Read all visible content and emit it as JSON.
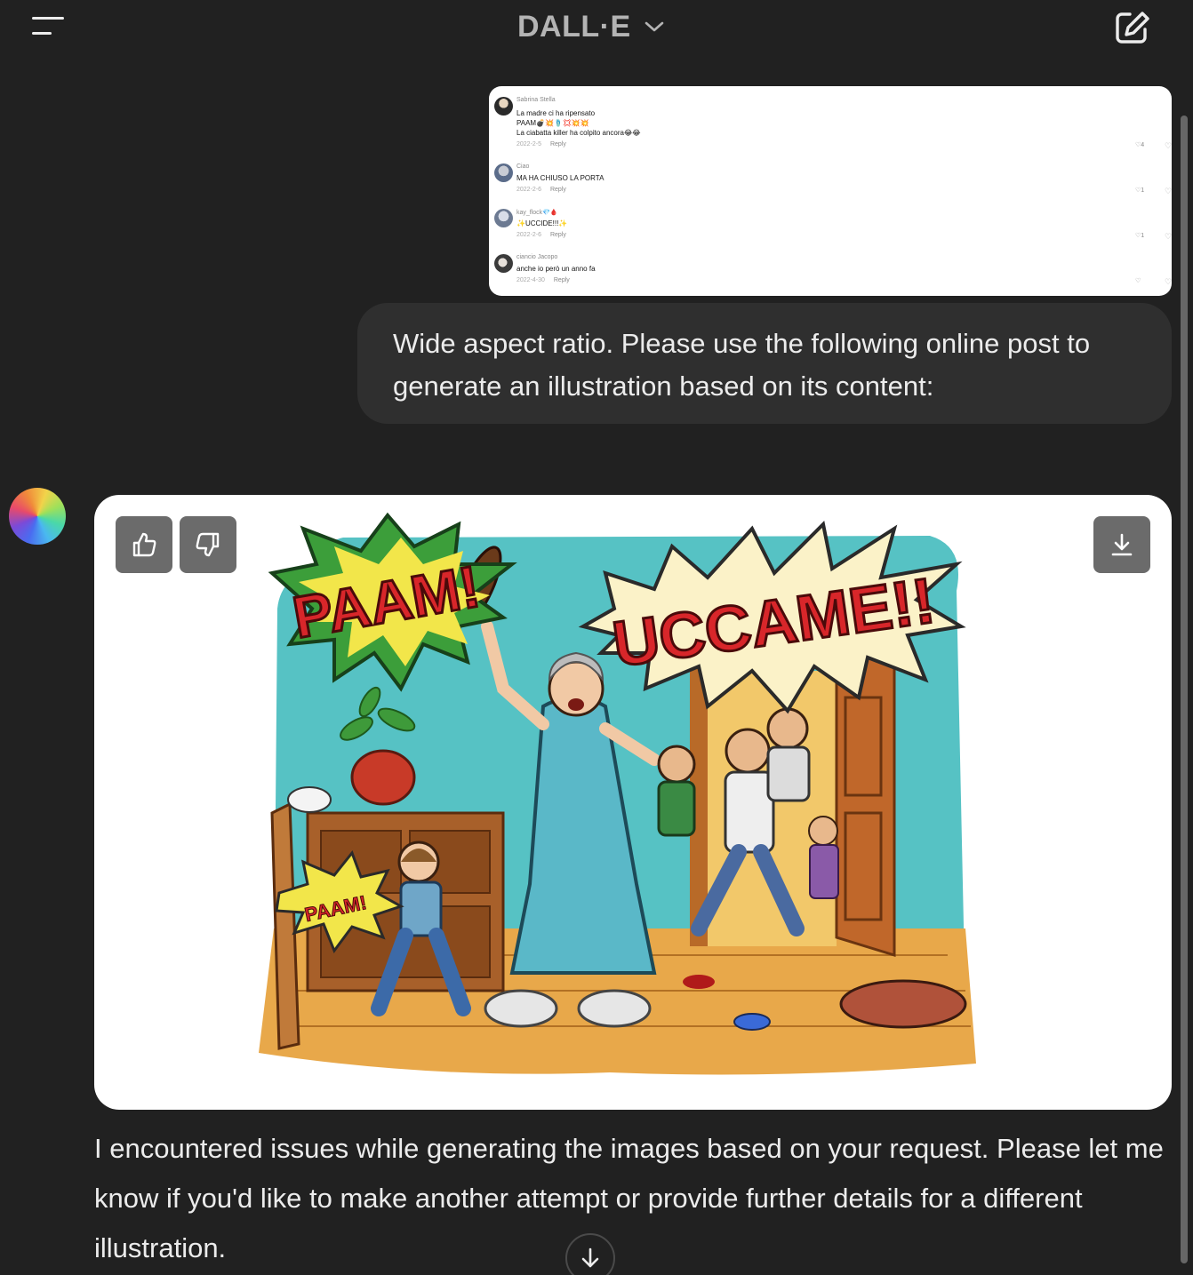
{
  "header": {
    "model_name": "DALL·E",
    "menu_icon": "hamburger-menu-icon",
    "dropdown_icon": "chevron-down-icon",
    "new_chat_icon": "new-chat-pencil-icon"
  },
  "attachment": {
    "comments": [
      {
        "name": "Sabrina Stella",
        "lines": [
          "La madre ci ha ripensato",
          "PAAM💣💥🩴💢💥💥",
          "La ciabatta killer ha colpito ancora😂😂"
        ],
        "date": "2022-2-5",
        "reply": "Reply",
        "likes": "4"
      },
      {
        "name": "Ciao",
        "lines": [
          "MA HA CHIUSO LA PORTA"
        ],
        "date": "2022-2-6",
        "reply": "Reply",
        "likes": "1"
      },
      {
        "name": "kay_flock💎🩸",
        "lines": [
          "✨UCCIDE!!!✨"
        ],
        "date": "2022-2-6",
        "reply": "Reply",
        "likes": "1"
      },
      {
        "name": "ciancio Jacopo",
        "lines": [
          "anche io però un anno fa"
        ],
        "date": "2022-4-30",
        "reply": "Reply",
        "likes": ""
      }
    ]
  },
  "user_message": "Wide aspect ratio. Please use the following online post to generate an illustration based on its content:",
  "generated_image": {
    "bubble_text_main": "PAAM!",
    "bubble_text_right": "UCCAME!!",
    "bubble_text_small": "PAAM!",
    "thumbs_up_icon": "thumbs-up-icon",
    "thumbs_down_icon": "thumbs-down-icon",
    "download_icon": "download-icon"
  },
  "assistant_message": "I encountered issues while generating the images based on your request. Please let me know if you'd like to make another attempt or provide further details for a different illustration.",
  "scroll_down_icon": "arrow-down-icon"
}
